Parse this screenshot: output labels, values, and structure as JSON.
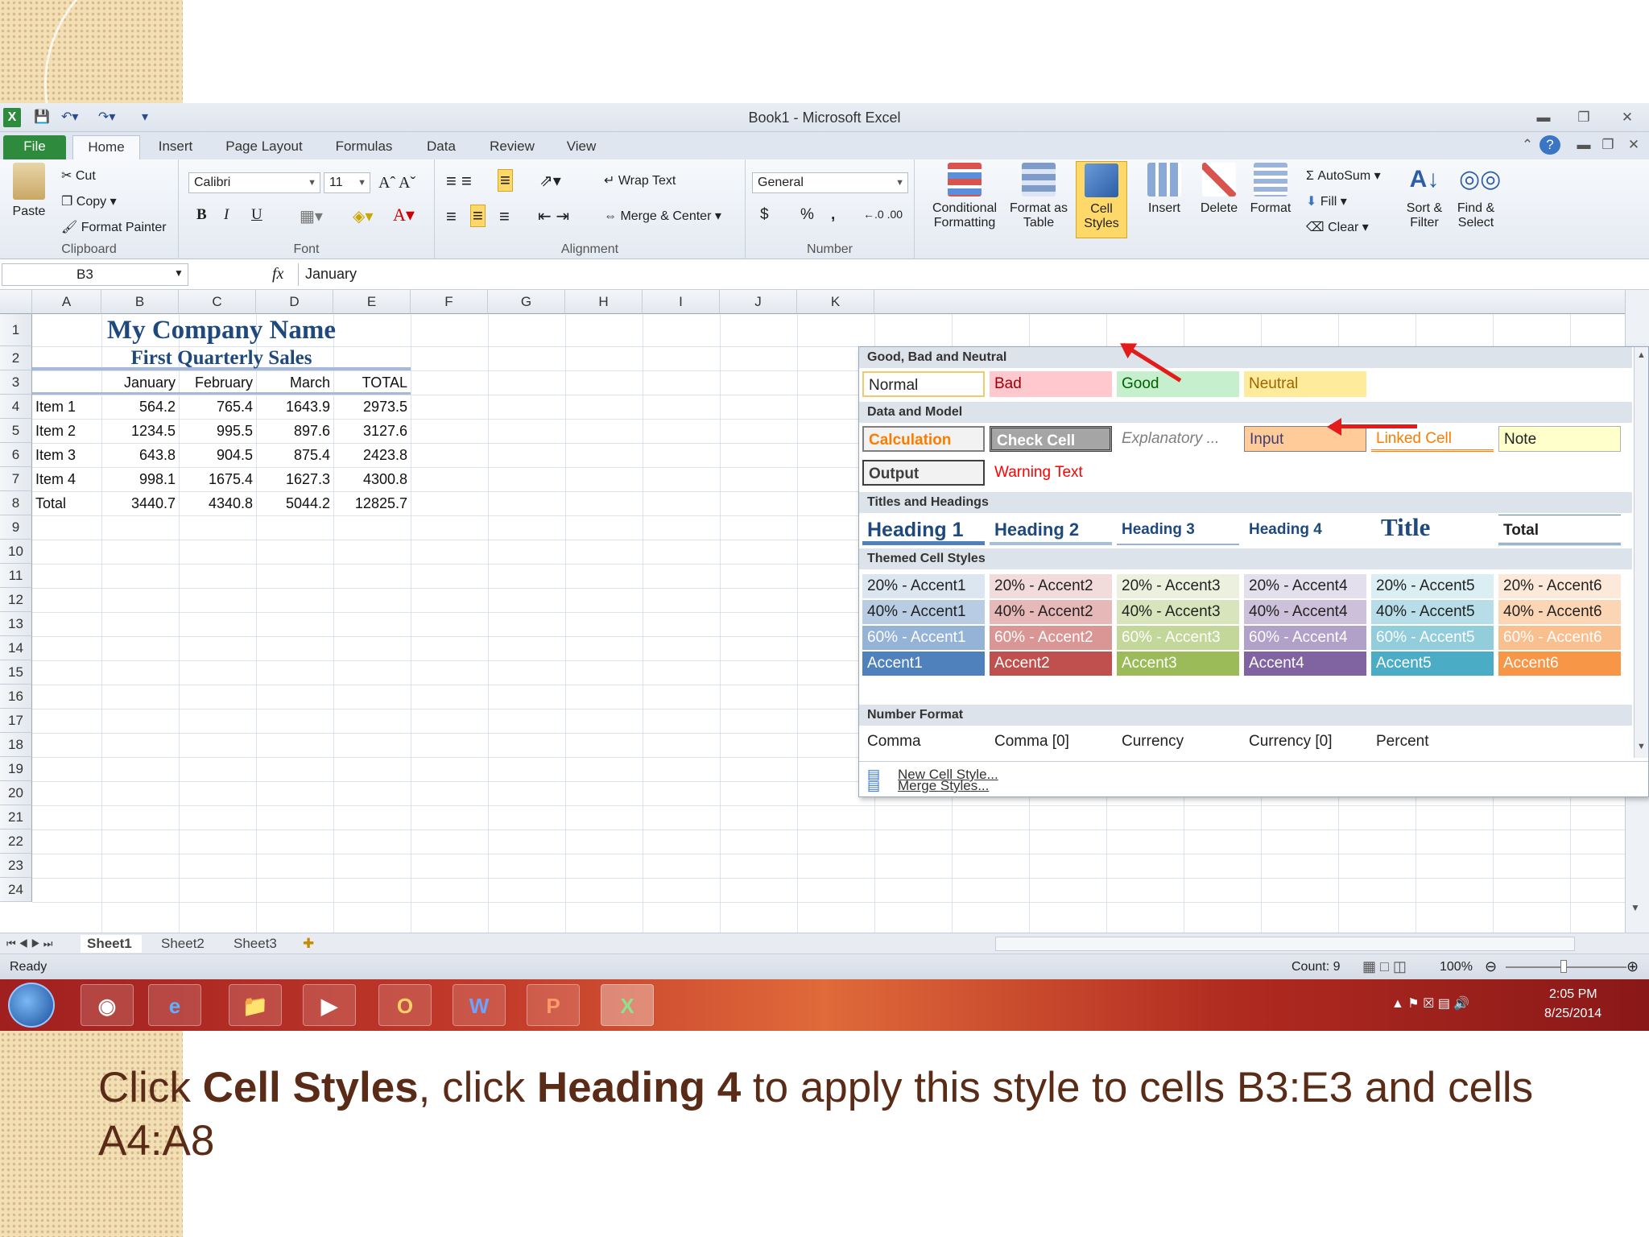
{
  "window": {
    "title": "Book1  -  Microsoft Excel",
    "tabs": [
      "File",
      "Home",
      "Insert",
      "Page Layout",
      "Formulas",
      "Data",
      "Review",
      "View"
    ]
  },
  "ribbon": {
    "clipboard": {
      "label": "Clipboard",
      "paste": "Paste",
      "cut": "Cut",
      "copy": "Copy",
      "format_painter": "Format Painter"
    },
    "font": {
      "label": "Font",
      "name": "Calibri",
      "size": "11",
      "bold": "B",
      "italic": "I",
      "underline": "U"
    },
    "alignment": {
      "label": "Alignment",
      "wrap": "Wrap Text",
      "merge": "Merge & Center"
    },
    "number": {
      "label": "Number",
      "format": "General",
      "currency": "$",
      "percent": "%",
      "comma": ","
    },
    "styles": {
      "conditional": "Conditional Formatting",
      "format_table": "Format as Table",
      "cell_styles": "Cell Styles"
    },
    "cells": {
      "insert": "Insert",
      "delete": "Delete",
      "format": "Format"
    },
    "editing": {
      "autosum": "AutoSum",
      "fill": "Fill",
      "clear": "Clear",
      "sort": "Sort & Filter",
      "find": "Find & Select"
    }
  },
  "formula_bar": {
    "name_box": "B3",
    "fx": "fx",
    "value": "January"
  },
  "sheet": {
    "columns": [
      "A",
      "B",
      "C",
      "D",
      "E",
      "F",
      "G",
      "H",
      "I",
      "J",
      "K"
    ],
    "rows": [
      "1",
      "2",
      "3",
      "4",
      "5",
      "6",
      "7",
      "8",
      "9",
      "10",
      "11",
      "12",
      "13",
      "14",
      "15",
      "16",
      "17",
      "18",
      "19",
      "20",
      "21",
      "22",
      "23",
      "24"
    ],
    "title": "My Company Name",
    "subtitle": "First Quarterly Sales",
    "headers": [
      "January",
      "February",
      "March",
      "TOTAL"
    ],
    "data": [
      {
        "item": "Item 1",
        "jan": "564.2",
        "feb": "765.4",
        "mar": "1643.9",
        "total": "2973.5"
      },
      {
        "item": "Item 2",
        "jan": "1234.5",
        "feb": "995.5",
        "mar": "897.6",
        "total": "3127.6"
      },
      {
        "item": "Item 3",
        "jan": "643.8",
        "feb": "904.5",
        "mar": "875.4",
        "total": "2423.8"
      },
      {
        "item": "Item 4",
        "jan": "998.1",
        "feb": "1675.4",
        "mar": "1627.3",
        "total": "4300.8"
      },
      {
        "item": "Total",
        "jan": "3440.7",
        "feb": "4340.8",
        "mar": "5044.2",
        "total": "12825.7"
      }
    ],
    "tabs": [
      "Sheet1",
      "Sheet2",
      "Sheet3"
    ]
  },
  "gallery": {
    "sections": [
      "Good, Bad and Neutral",
      "Data and Model",
      "Titles and Headings",
      "Themed Cell Styles",
      "Number Format"
    ],
    "good_bad": [
      "Normal",
      "Bad",
      "Good",
      "Neutral"
    ],
    "data_model": [
      "Calculation",
      "Check Cell",
      "Explanatory ...",
      "Input",
      "Linked Cell",
      "Note",
      "Output",
      "Warning Text"
    ],
    "titles": [
      "Heading 1",
      "Heading 2",
      "Heading 3",
      "Heading 4",
      "Title",
      "Total"
    ],
    "accent20": [
      "20% - Accent1",
      "20% - Accent2",
      "20% - Accent3",
      "20% - Accent4",
      "20% - Accent5",
      "20% - Accent6"
    ],
    "accent40": [
      "40% - Accent1",
      "40% - Accent2",
      "40% - Accent3",
      "40% - Accent4",
      "40% - Accent5",
      "40% - Accent6"
    ],
    "accent60": [
      "60% - Accent1",
      "60% - Accent2",
      "60% - Accent3",
      "60% - Accent4",
      "60% - Accent5",
      "60% - Accent6"
    ],
    "accent": [
      "Accent1",
      "Accent2",
      "Accent3",
      "Accent4",
      "Accent5",
      "Accent6"
    ],
    "number": [
      "Comma",
      "Comma [0]",
      "Currency",
      "Currency [0]",
      "Percent"
    ],
    "new_style": "New Cell Style...",
    "merge_styles": "Merge Styles..."
  },
  "status": {
    "ready": "Ready",
    "count": "Count: 9",
    "zoom": "100%"
  },
  "taskbar": {
    "time": "2:05 PM",
    "date": "8/25/2014"
  },
  "caption": {
    "t1": "Click ",
    "b1": "Cell Styles",
    "t2": ", click ",
    "b2": "Heading 4",
    "t3": " to apply this style to cells B3:E3 and cells A4:A8"
  },
  "colors": {
    "excel_green": "#2e8b3d",
    "heading_blue": "#1f497d",
    "arrow_red": "#e41b1b",
    "caption_brown": "#5a2b16"
  }
}
